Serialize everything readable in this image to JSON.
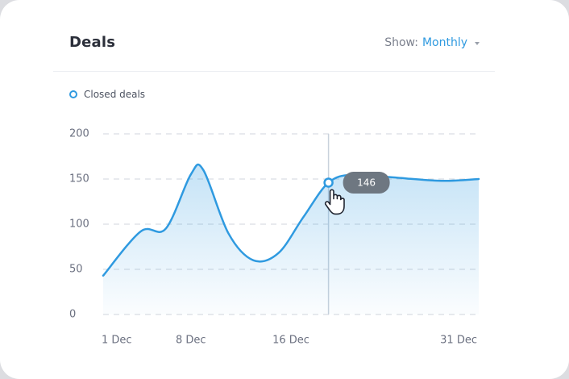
{
  "card": {
    "title": "Deals",
    "show_label": "Show:",
    "show_value": "Monthly"
  },
  "colors": {
    "accent": "#2f9ae0",
    "tooltip": "#6e7781"
  },
  "icons": {
    "dropdown": "chevron-down-icon",
    "cursor": "hand-pointer-icon"
  },
  "chart_data": {
    "type": "area",
    "series": [
      {
        "name": "Closed deals",
        "x": [
          "1 Dec",
          "4 Dec",
          "6 Dec",
          "8 Dec",
          "9 Dec",
          "11 Dec",
          "13 Dec",
          "15 Dec",
          "17 Dec",
          "19 Dec",
          "21 Dec",
          "24 Dec",
          "28 Dec",
          "31 Dec"
        ],
        "values": [
          43,
          92,
          95,
          155,
          160,
          90,
          60,
          68,
          108,
          146,
          155,
          152,
          148,
          150
        ]
      }
    ],
    "x_ticks": [
      "1 Dec",
      "8 Dec",
      "16 Dec",
      "31 Dec"
    ],
    "y_ticks": [
      0,
      50,
      100,
      150,
      200
    ],
    "ylim": [
      0,
      200
    ],
    "grid": true,
    "tooltip": {
      "x": "19 Dec",
      "value": 146,
      "text": "146"
    }
  }
}
